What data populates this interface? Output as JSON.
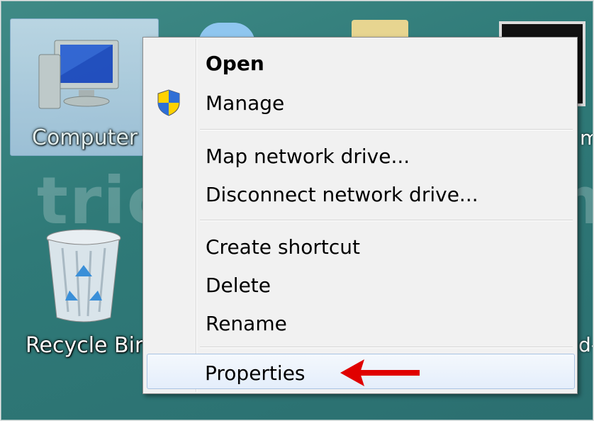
{
  "desktop": {
    "icons": [
      {
        "label": "Computer",
        "icon": "computer-icon"
      },
      {
        "label": "Recycle Bin",
        "icon": "recycle-bin-icon"
      }
    ],
    "watermark": "trickyways.com"
  },
  "context_menu": {
    "items": [
      {
        "label": "Open",
        "bold": true
      },
      {
        "label": "Manage",
        "icon": "uac-shield-icon"
      },
      {
        "label": "Map network drive..."
      },
      {
        "label": "Disconnect network drive..."
      },
      {
        "label": "Create shortcut"
      },
      {
        "label": "Delete"
      },
      {
        "label": "Rename"
      },
      {
        "label": "Properties",
        "highlighted": true
      }
    ]
  },
  "annotation": {
    "arrow_color": "#e00000"
  }
}
